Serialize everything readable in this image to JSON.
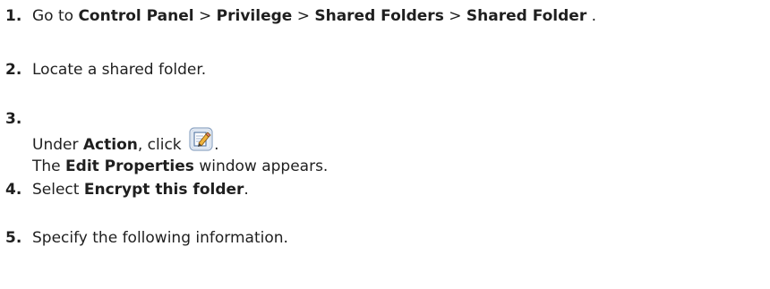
{
  "steps": [
    {
      "number": "1.",
      "go_to": "Go to",
      "path": [
        "Control Panel",
        "Privilege",
        "Shared Folders",
        "Shared Folder"
      ],
      "separator": ">",
      "end": "."
    },
    {
      "number": "2.",
      "text": "Locate a shared folder."
    },
    {
      "number": "3.",
      "under": "Under",
      "action": "Action",
      "click": ", click",
      "icon": "edit-icon",
      "end": ".",
      "result_the": "The",
      "result_window": "Edit Properties",
      "result_rest": "window appears."
    },
    {
      "number": "4.",
      "select": "Select",
      "option": "Encrypt this folder",
      "end": "."
    },
    {
      "number": "5.",
      "text": "Specify the following information."
    }
  ],
  "colors": {
    "text": "#1f1f1f",
    "icon_border": "#7a9abf",
    "icon_fill": "#e9eff7"
  }
}
